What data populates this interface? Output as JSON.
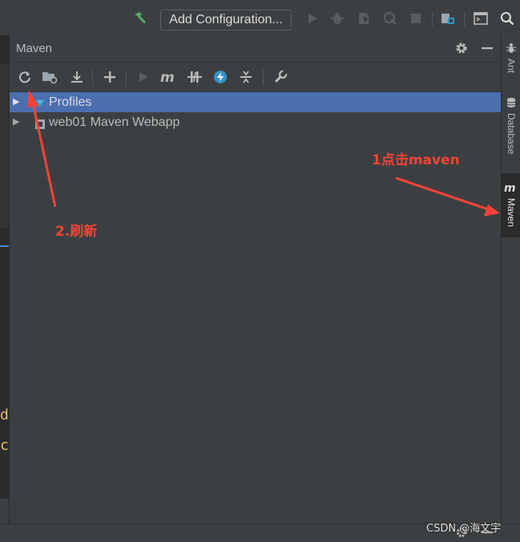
{
  "toolbar": {
    "add_config_label": "Add Configuration..."
  },
  "maven_panel": {
    "title": "Maven",
    "tree": [
      {
        "label": "Profiles",
        "selected": true
      },
      {
        "label": "web01 Maven Webapp",
        "selected": false
      }
    ]
  },
  "right_strip": {
    "tabs": [
      {
        "label": "Ant",
        "icon": "ant-icon"
      },
      {
        "label": "Database",
        "icon": "database-icon"
      },
      {
        "label": "Maven",
        "icon": "maven-icon",
        "active": true
      }
    ]
  },
  "editor_gutter": {
    "chars": [
      "d",
      "c"
    ]
  },
  "annotations": {
    "click_maven": "1点击maven",
    "refresh": "2.刷新"
  },
  "watermark": "CSDN @海文宇",
  "colors": {
    "background": "#3c3f41",
    "selection": "#4b6eaf",
    "annotation": "#f44336",
    "build_green": "#59a869"
  }
}
